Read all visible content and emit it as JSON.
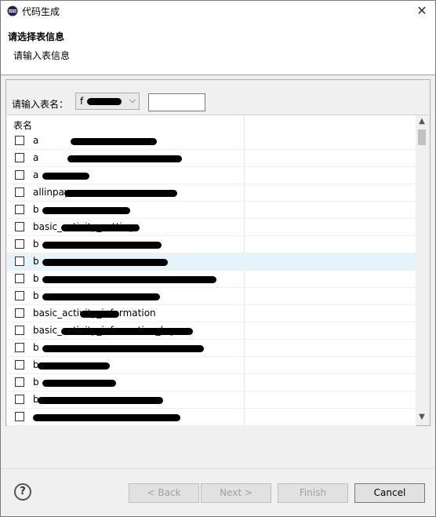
{
  "window": {
    "title": "代码生成",
    "close_glyph": "✕"
  },
  "header": {
    "title": "请选择表信息",
    "description": "请输入表信息"
  },
  "form": {
    "table_label": "请输入表名：",
    "combo_value": "f",
    "combo_arrow": "⌵",
    "filter_value": ""
  },
  "table": {
    "column_header": "表名",
    "rows": [
      {
        "text": "a",
        "selected": false
      },
      {
        "text": "a",
        "selected": false
      },
      {
        "text": "a",
        "selected": false
      },
      {
        "text": "allinpay",
        "selected": false
      },
      {
        "text": "b",
        "selected": false
      },
      {
        "text": "basic_activity_settings",
        "selected": false
      },
      {
        "text": "b",
        "selected": false
      },
      {
        "text": "b",
        "selected": true
      },
      {
        "text": "b",
        "selected": false
      },
      {
        "text": "b",
        "selected": false
      },
      {
        "text": "basic_activity_information",
        "selected": false
      },
      {
        "text": "basic_activity_information_log",
        "selected": false
      },
      {
        "text": "b",
        "selected": false
      },
      {
        "text": "b",
        "selected": false
      },
      {
        "text": "b",
        "selected": false
      },
      {
        "text": "b",
        "selected": false
      },
      {
        "text": "",
        "selected": false
      }
    ]
  },
  "buttons": {
    "back": "< Back",
    "next": "Next >",
    "finish": "Finish",
    "cancel": "Cancel"
  }
}
